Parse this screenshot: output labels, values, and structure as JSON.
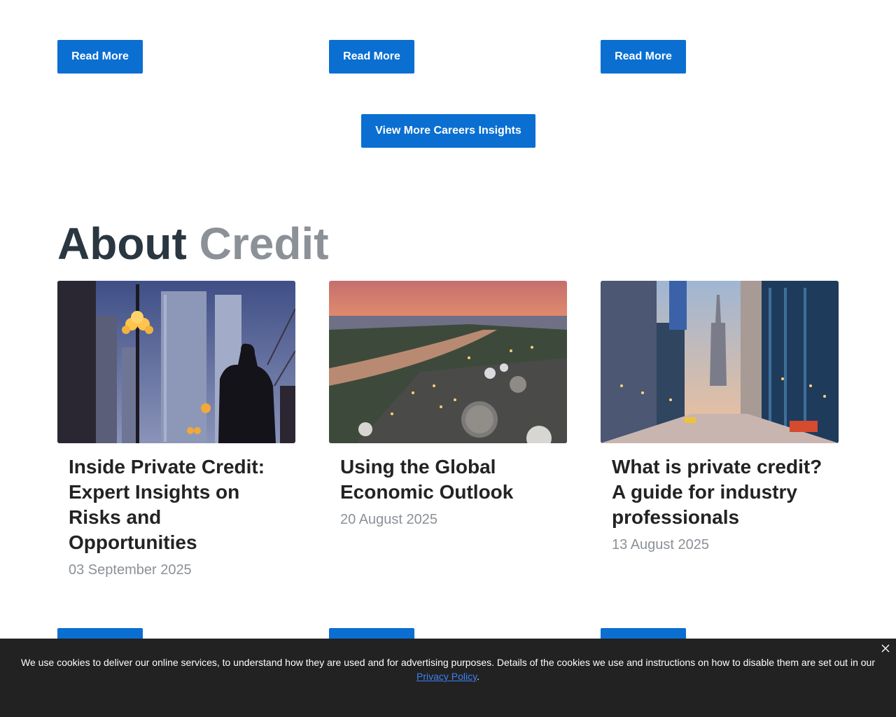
{
  "top_row": {
    "read_more": [
      "Read More",
      "Read More",
      "Read More"
    ]
  },
  "view_more_label": "View More Careers Insights",
  "section": {
    "title_part1": "About",
    "title_part2": "Credit"
  },
  "cards": [
    {
      "title": "Inside Private Credit: Expert Insights on Risks and Opportunities",
      "date": "03 September 2025",
      "image": "man-city-street-lamps-photo",
      "read_more": ""
    },
    {
      "title": "Using the Global Economic Outlook",
      "date": "20 August 2025",
      "image": "refinery-river-sunset-photo",
      "read_more": ""
    },
    {
      "title": "What is private credit? A guide for industry professionals",
      "date": "13 August 2025",
      "image": "new-york-street-dusk-photo",
      "read_more": ""
    }
  ],
  "cookie": {
    "text": "We use cookies to deliver our online services, to understand how they are used and for advertising purposes. Details of the cookies we use and instructions on how to disable them are set out in our ",
    "link": "Privacy Policy",
    "end": "."
  },
  "colors": {
    "button_blue": "#0a6fd1",
    "title_dark": "#2a3640",
    "title_grey": "#8b9197",
    "cookie_bg": "#222222"
  }
}
